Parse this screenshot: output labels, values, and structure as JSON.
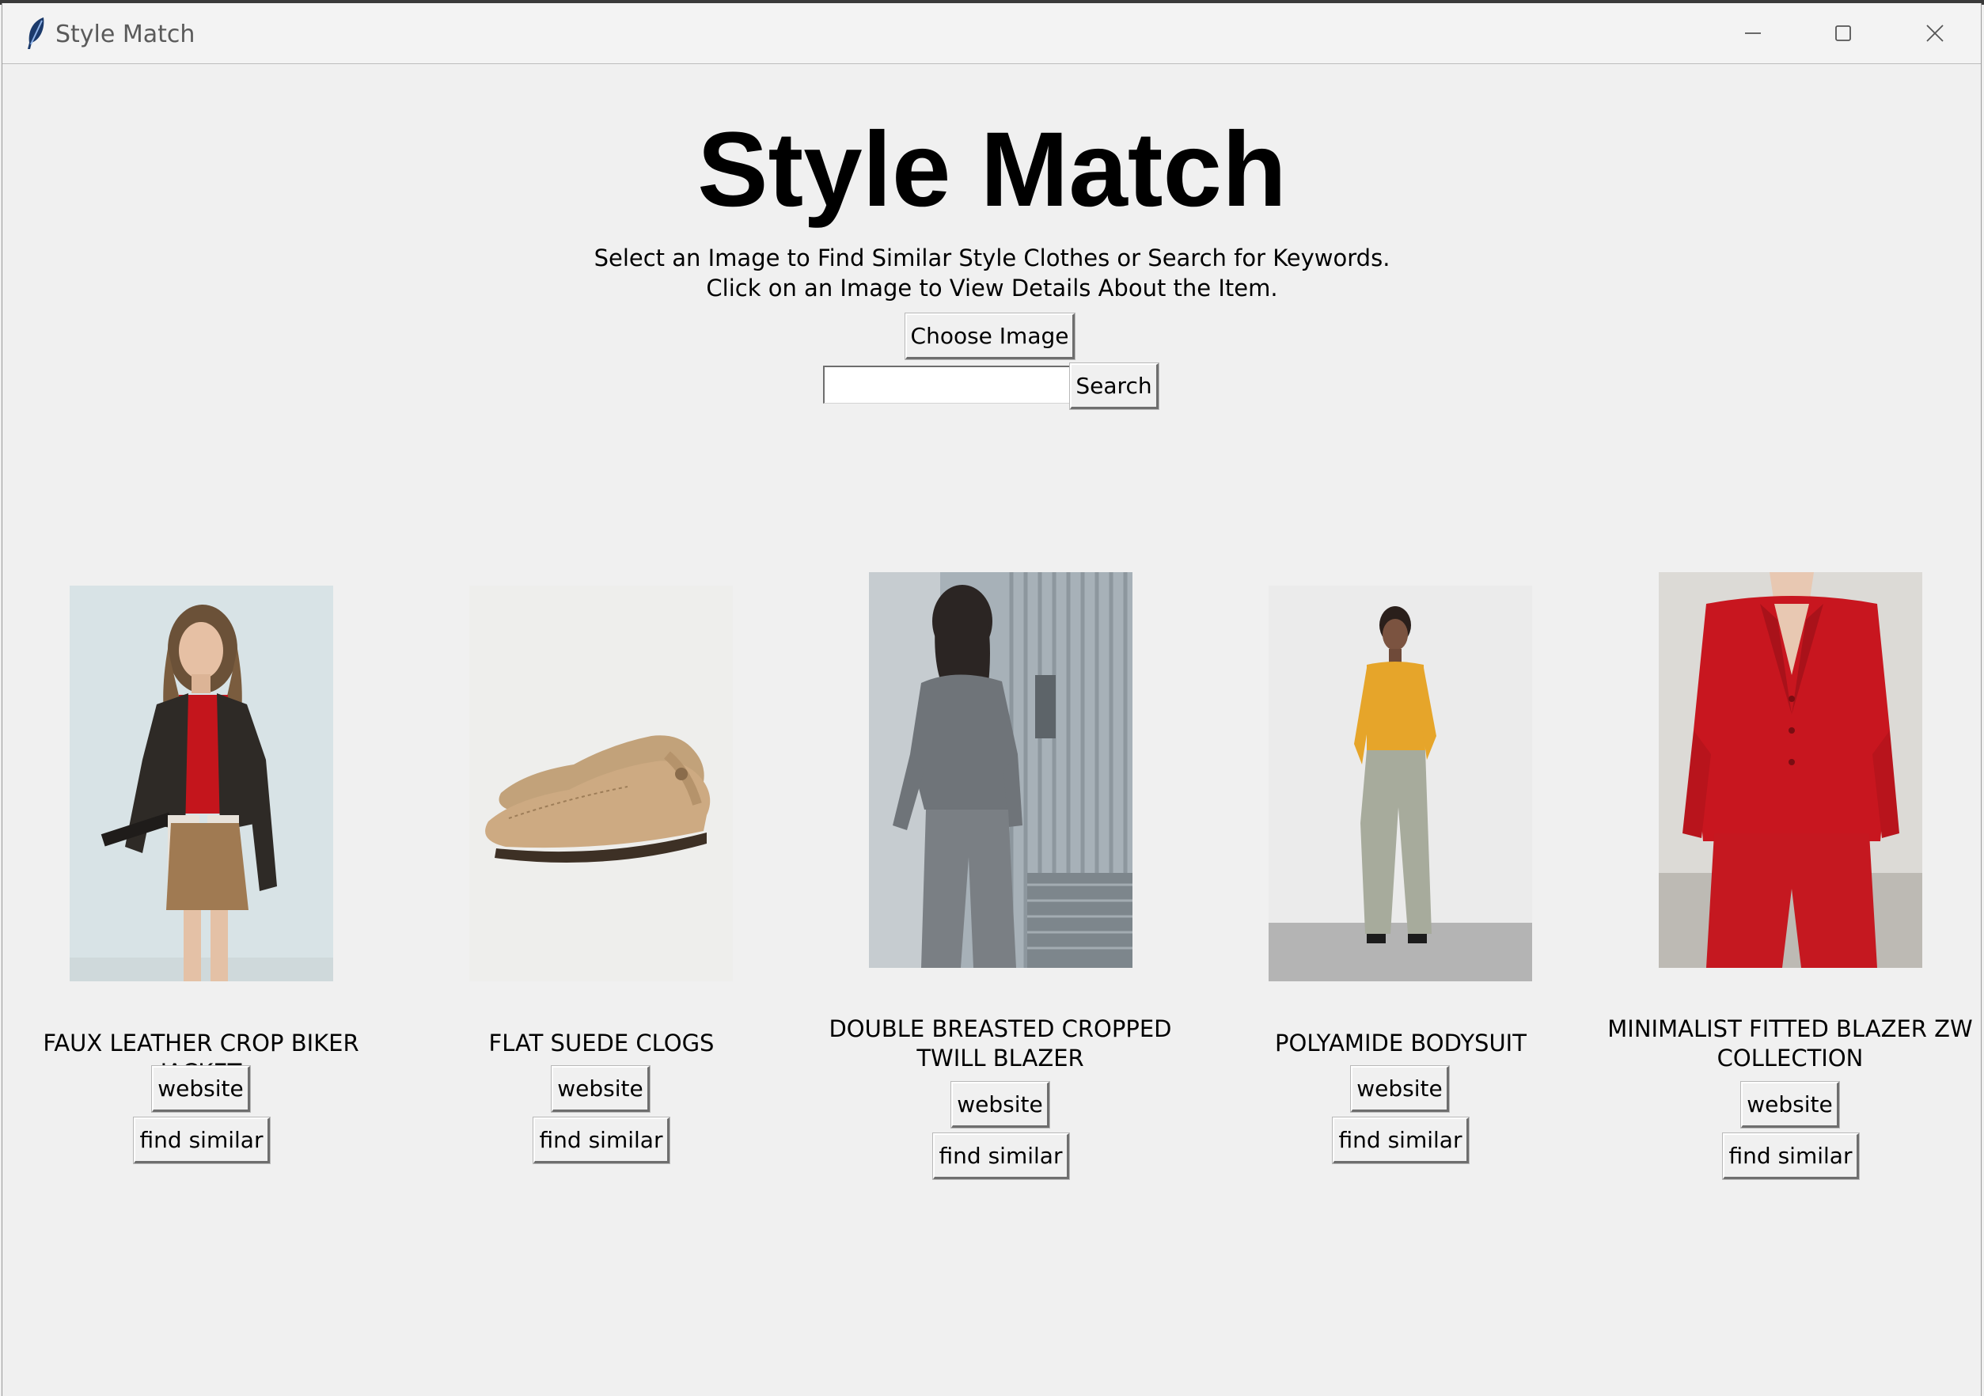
{
  "window": {
    "title": "Style Match"
  },
  "header": {
    "title": "Style Match",
    "instruction_line1": "Select an Image to Find Similar Style Clothes or Search for Keywords.",
    "instruction_line2": "Click on an Image to View Details About the Item."
  },
  "controls": {
    "choose_image_label": "Choose Image",
    "search_value": "",
    "search_label": "Search"
  },
  "products": [
    {
      "name": "FAUX LEATHER CROP BIKER JACKET",
      "website_label": "website",
      "find_similar_label": "find similar"
    },
    {
      "name": "FLAT SUEDE CLOGS",
      "website_label": "website",
      "find_similar_label": "find similar"
    },
    {
      "name": "DOUBLE BREASTED CROPPED TWILL BLAZER",
      "website_label": "website",
      "find_similar_label": "find similar"
    },
    {
      "name": "POLYAMIDE BODYSUIT",
      "website_label": "website",
      "find_similar_label": "find similar"
    },
    {
      "name": "MINIMALIST FITTED BLAZER ZW COLLECTION",
      "website_label": "website",
      "find_similar_label": "find similar"
    }
  ],
  "colors": {
    "background": "#f0f0f0",
    "text": "#000000"
  }
}
